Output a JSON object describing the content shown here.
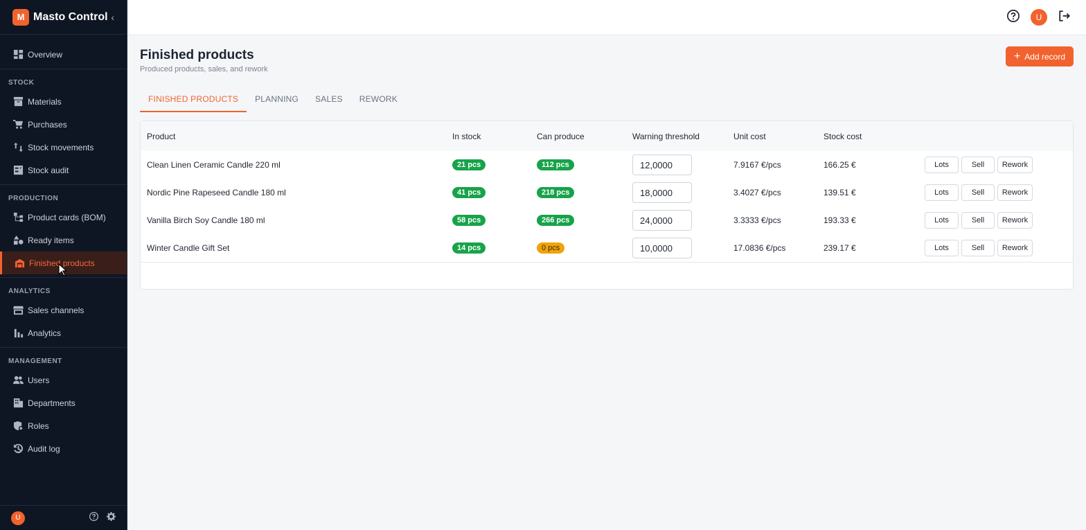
{
  "app": {
    "logo_letter": "M",
    "name": "Masto Control",
    "collapse_icon": "chevron-left-icon"
  },
  "sidebar": {
    "overview": "Overview",
    "sections": {
      "stock": "STOCK",
      "production": "PRODUCTION",
      "analytics": "ANALYTICS",
      "management": "MANAGEMENT"
    },
    "stock_items": [
      "Materials",
      "Purchases",
      "Stock movements",
      "Stock audit"
    ],
    "production_items": [
      "Product cards (BOM)",
      "Ready items",
      "Finished products"
    ],
    "analytics_items": [
      "Sales channels",
      "Analytics"
    ],
    "management_items": [
      "Users",
      "Departments",
      "Roles",
      "Audit log"
    ],
    "footer_avatar": "U"
  },
  "topbar": {
    "avatar": "U"
  },
  "page": {
    "title": "Finished products",
    "subtitle": "Produced products, sales, and rework",
    "add_label": "Add record"
  },
  "tabs": [
    "FINISHED PRODUCTS",
    "PLANNING",
    "SALES",
    "REWORK"
  ],
  "table": {
    "headers": [
      "Product",
      "In stock",
      "Can produce",
      "Warning threshold",
      "Unit cost",
      "Stock cost"
    ],
    "actions": {
      "lots": "Lots",
      "sell": "Sell",
      "rework": "Rework"
    },
    "rows": [
      {
        "product": "Clean Linen Ceramic Candle 220 ml",
        "in_stock": "21 pcs",
        "can_produce": "112 pcs",
        "threshold": "12,0000",
        "unit_cost": "7.9167 €/pcs",
        "stock_cost": "166.25 €"
      },
      {
        "product": "Nordic Pine Rapeseed Candle 180 ml",
        "in_stock": "41 pcs",
        "can_produce": "218 pcs",
        "threshold": "18,0000",
        "unit_cost": "3.4027 €/pcs",
        "stock_cost": "139.51 €"
      },
      {
        "product": "Vanilla Birch Soy Candle 180 ml",
        "in_stock": "58 pcs",
        "can_produce": "266 pcs",
        "threshold": "24,0000",
        "unit_cost": "3.3333 €/pcs",
        "stock_cost": "193.33 €"
      },
      {
        "product": "Winter Candle Gift Set",
        "in_stock": "14 pcs",
        "can_produce": "0 pcs",
        "threshold": "10,0000",
        "unit_cost": "17.0836 €/pcs",
        "stock_cost": "239.17 €"
      }
    ]
  },
  "colors": {
    "accent": "#f2622e",
    "sidebar_bg": "#0f1623",
    "badge_ok": "#17a34a",
    "badge_warn": "#f0a30c"
  }
}
